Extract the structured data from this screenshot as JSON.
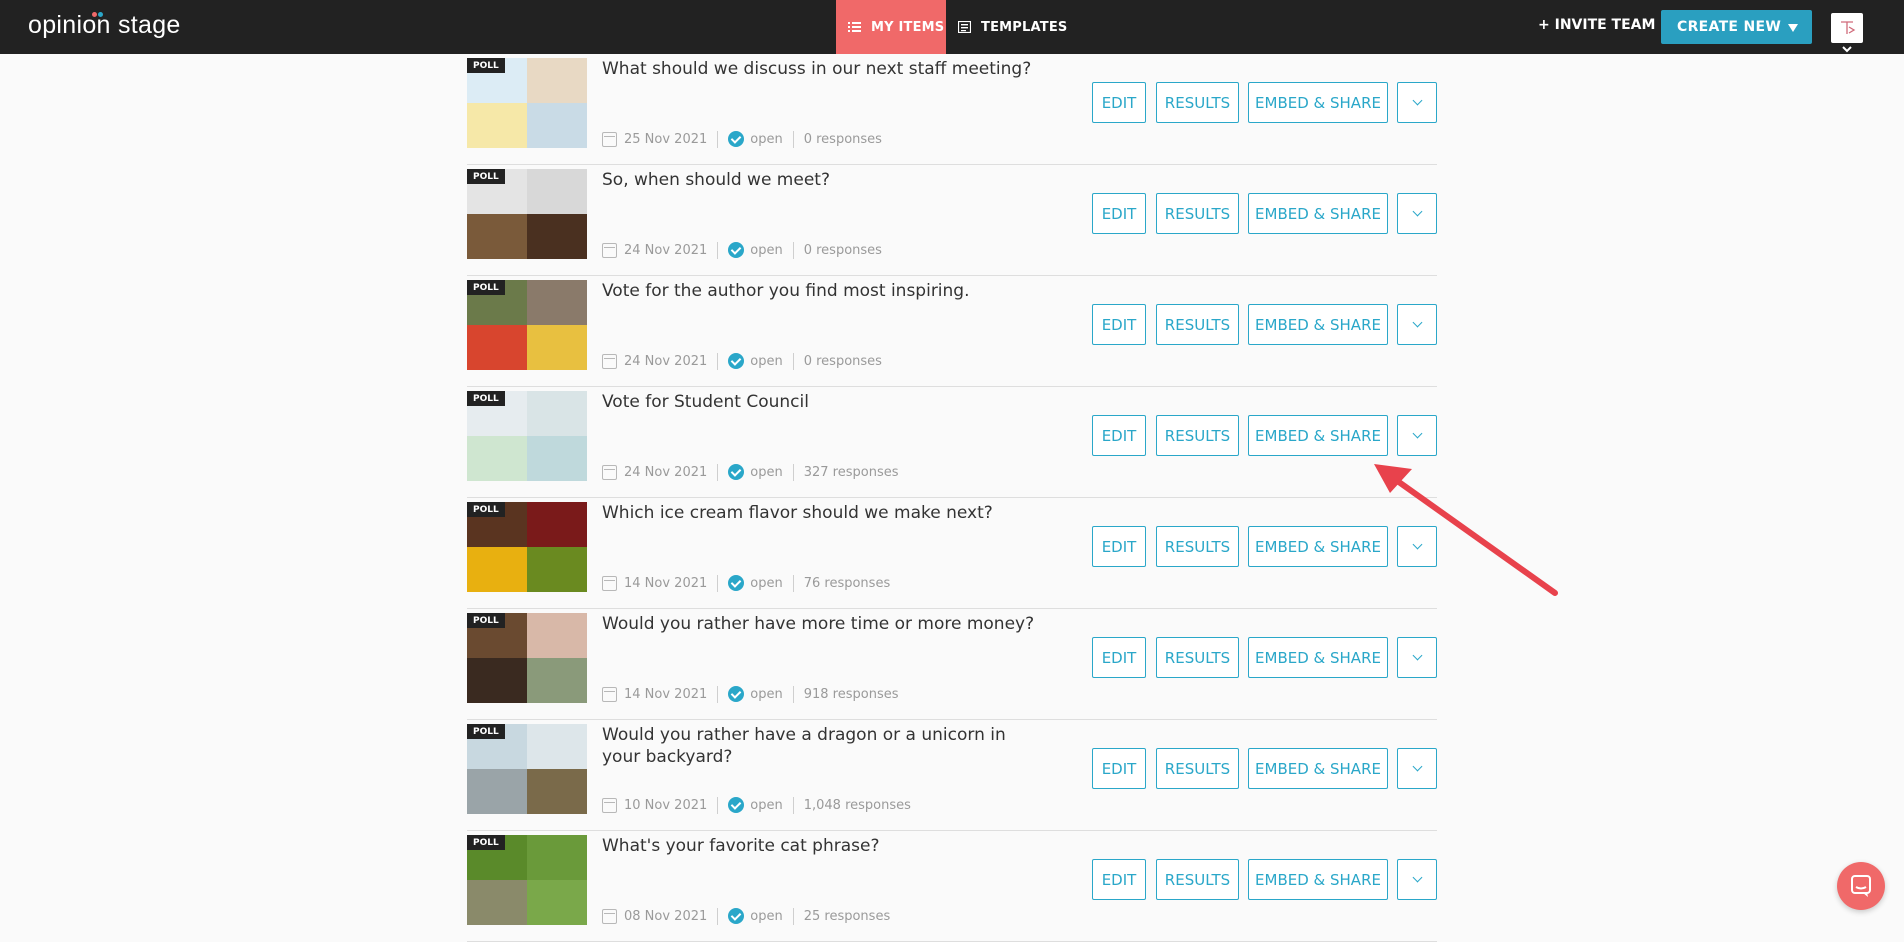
{
  "app": {
    "logo_text": "opinion stage",
    "brand_color": "#f06969",
    "accent_color": "#2aa7c9"
  },
  "nav": {
    "my_items": "MY ITEMS",
    "templates": "TEMPLATES",
    "invite_team": "+ INVITE TEAM",
    "create_new": "CREATE NEW"
  },
  "item_actions": {
    "edit": "EDIT",
    "results": "RESULTS",
    "embed_share": "EMBED & SHARE"
  },
  "items": [
    {
      "type": "POLL",
      "title": "What should we discuss in our next staff meeting?",
      "date": "25 Nov 2021",
      "status": "open",
      "responses": "0 responses",
      "thumb_colors": [
        "#dcecf5",
        "#e8d9c4",
        "#f6e8a8",
        "#c9dbe6"
      ]
    },
    {
      "type": "POLL",
      "title": "So, when should we meet?",
      "date": "24 Nov 2021",
      "status": "open",
      "responses": "0 responses",
      "thumb_colors": [
        "#e4e4e4",
        "#d8d8d8",
        "#7a5a3a",
        "#4a3020"
      ]
    },
    {
      "type": "POLL",
      "title": "Vote for the author you find most inspiring.",
      "date": "24 Nov 2021",
      "status": "open",
      "responses": "0 responses",
      "thumb_colors": [
        "#6b7a4a",
        "#8a7a6a",
        "#d8452e",
        "#e8c040"
      ]
    },
    {
      "type": "POLL",
      "title": "Vote for Student Council",
      "date": "24 Nov 2021",
      "status": "open",
      "responses": "327 responses",
      "thumb_colors": [
        "#e6ecef",
        "#d9e4e6",
        "#cfe6d0",
        "#bfd9dc"
      ]
    },
    {
      "type": "POLL",
      "title": "Which ice cream flavor should we make next?",
      "date": "14 Nov 2021",
      "status": "open",
      "responses": "76 responses",
      "thumb_colors": [
        "#5a3420",
        "#7a1a1a",
        "#e8b010",
        "#6a8a20"
      ]
    },
    {
      "type": "POLL",
      "title": "Would you rather have more time or more money?",
      "date": "14 Nov 2021",
      "status": "open",
      "responses": "918 responses",
      "thumb_colors": [
        "#6a4a30",
        "#d8b8a8",
        "#3a2a20",
        "#8a9a7a"
      ]
    },
    {
      "type": "POLL",
      "title": "Would you rather have a dragon or a unicorn in your backyard?",
      "date": "10 Nov 2021",
      "status": "open",
      "responses": "1,048 responses",
      "thumb_colors": [
        "#c8d8e0",
        "#dde6ea",
        "#9aa4a8",
        "#7a6a4a"
      ]
    },
    {
      "type": "POLL",
      "title": "What's your favorite cat phrase?",
      "date": "08 Nov 2021",
      "status": "open",
      "responses": "25 responses",
      "thumb_colors": [
        "#5a8a2a",
        "#6a9a3a",
        "#8a8a6a",
        "#7aa84a"
      ]
    }
  ]
}
